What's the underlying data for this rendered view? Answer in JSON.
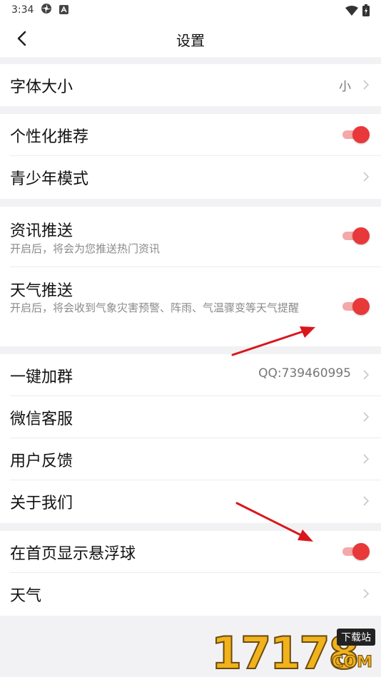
{
  "status_bar": {
    "time": "3:34",
    "icons": [
      "pinwheel-icon",
      "accessibility-a-icon",
      "wifi-icon",
      "battery-charging-icon"
    ]
  },
  "header": {
    "title": "设置",
    "back_icon": "chevron-left-icon"
  },
  "groups": [
    {
      "items": [
        {
          "label": "字体大小",
          "value": "小",
          "control": "chevron"
        }
      ]
    },
    {
      "items": [
        {
          "label": "个性化推荐",
          "control": "toggle",
          "on": true
        },
        {
          "label": "青少年模式",
          "control": "chevron"
        }
      ]
    },
    {
      "items": [
        {
          "label": "资讯推送",
          "sub": "开启后，将会为您推送热门资讯",
          "control": "toggle",
          "on": true
        },
        {
          "label": "天气推送",
          "sub": "开启后，将会收到气象灾害预警、阵雨、气温骤变等天气提醒",
          "control": "toggle",
          "on": true
        }
      ]
    },
    {
      "items": [
        {
          "label": "一键加群",
          "value": "QQ:739460995",
          "control": "chevron"
        },
        {
          "label": "微信客服",
          "control": "chevron"
        },
        {
          "label": "用户反馈",
          "control": "chevron"
        },
        {
          "label": "关于我们",
          "control": "chevron"
        }
      ]
    },
    {
      "items": [
        {
          "label": "在首页显示悬浮球",
          "control": "toggle",
          "on": true
        },
        {
          "label": "天气",
          "control": "chevron"
        }
      ]
    }
  ],
  "watermark": {
    "digits": "17178",
    "badge": "下载站",
    "suffix": "COM"
  },
  "colors": {
    "accent": "#e8383a",
    "toggle_track": "#f4a8a8",
    "annotation_arrow": "#d9161c",
    "background": "#f2f2f4"
  }
}
